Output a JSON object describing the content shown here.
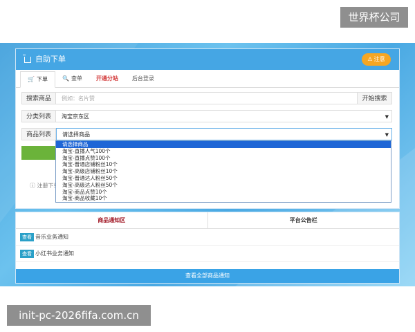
{
  "watermarks": {
    "top": "世界杯公司",
    "bottom": "init-pc-2026fifa.com.cn"
  },
  "panel": {
    "title": "自助下单",
    "tip_button": "注意"
  },
  "tabs": [
    {
      "label": "下单",
      "icon": "cart-icon"
    },
    {
      "label": "查单",
      "icon": "search-icon"
    },
    {
      "label": "开通分站",
      "icon": ""
    },
    {
      "label": "后台登录",
      "icon": ""
    }
  ],
  "search": {
    "label": "搜索商品",
    "placeholder": "例如：名片赞",
    "button": "开始搜索"
  },
  "category": {
    "label": "分类列表",
    "value": "淘宝京东区"
  },
  "product": {
    "label": "商品列表",
    "value": "请选择商品",
    "options": [
      "请选择商品",
      "淘宝-直播人气100个",
      "淘宝-直播点赞100个",
      "淘宝-普通店铺粉丝10个",
      "淘宝-高级店铺粉丝10个",
      "淘宝-普通达人粉丝50个",
      "淘宝-高级达人粉丝50个",
      "淘宝-商品点赞10个",
      "淘宝-商品收藏10个"
    ]
  },
  "note": "注册下单",
  "notice": {
    "left_header": "商品通知区",
    "right_header": "平台公告栏",
    "view_label": "查看",
    "items": [
      "音乐业务通知",
      "小红书业务通知"
    ],
    "view_all": "查看全部商品通知"
  },
  "colors": {
    "header_blue": "#45a6e4",
    "tip_orange": "#f5a623",
    "selected_option": "#1e66d6",
    "tab_red": "#d33a3a"
  }
}
